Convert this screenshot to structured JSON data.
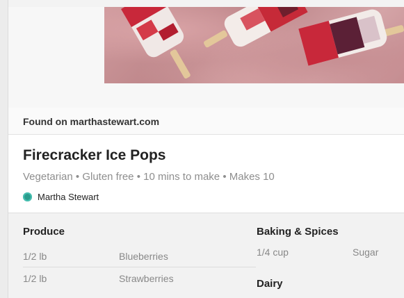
{
  "source": {
    "text": "Found on marthastewart.com"
  },
  "recipe": {
    "title": "Firecracker Ice Pops",
    "meta": "Vegetarian • Gluten free • 10 mins to make • Makes 10",
    "author": "Martha Stewart"
  },
  "ingredients": {
    "produce": {
      "title": "Produce",
      "items": [
        {
          "qty": "1/2 lb",
          "name": "Blueberries"
        },
        {
          "qty": "1/2 lb",
          "name": "Strawberries"
        }
      ]
    },
    "baking": {
      "title": "Baking & Spices",
      "items": [
        {
          "qty": "1/4 cup",
          "name": "Sugar"
        }
      ]
    },
    "dairy": {
      "title": "Dairy"
    }
  },
  "colors": {
    "author_dot": "#2b9c8d",
    "background_panel": "#f2f2f2",
    "meta_text": "#8e8e8e"
  }
}
